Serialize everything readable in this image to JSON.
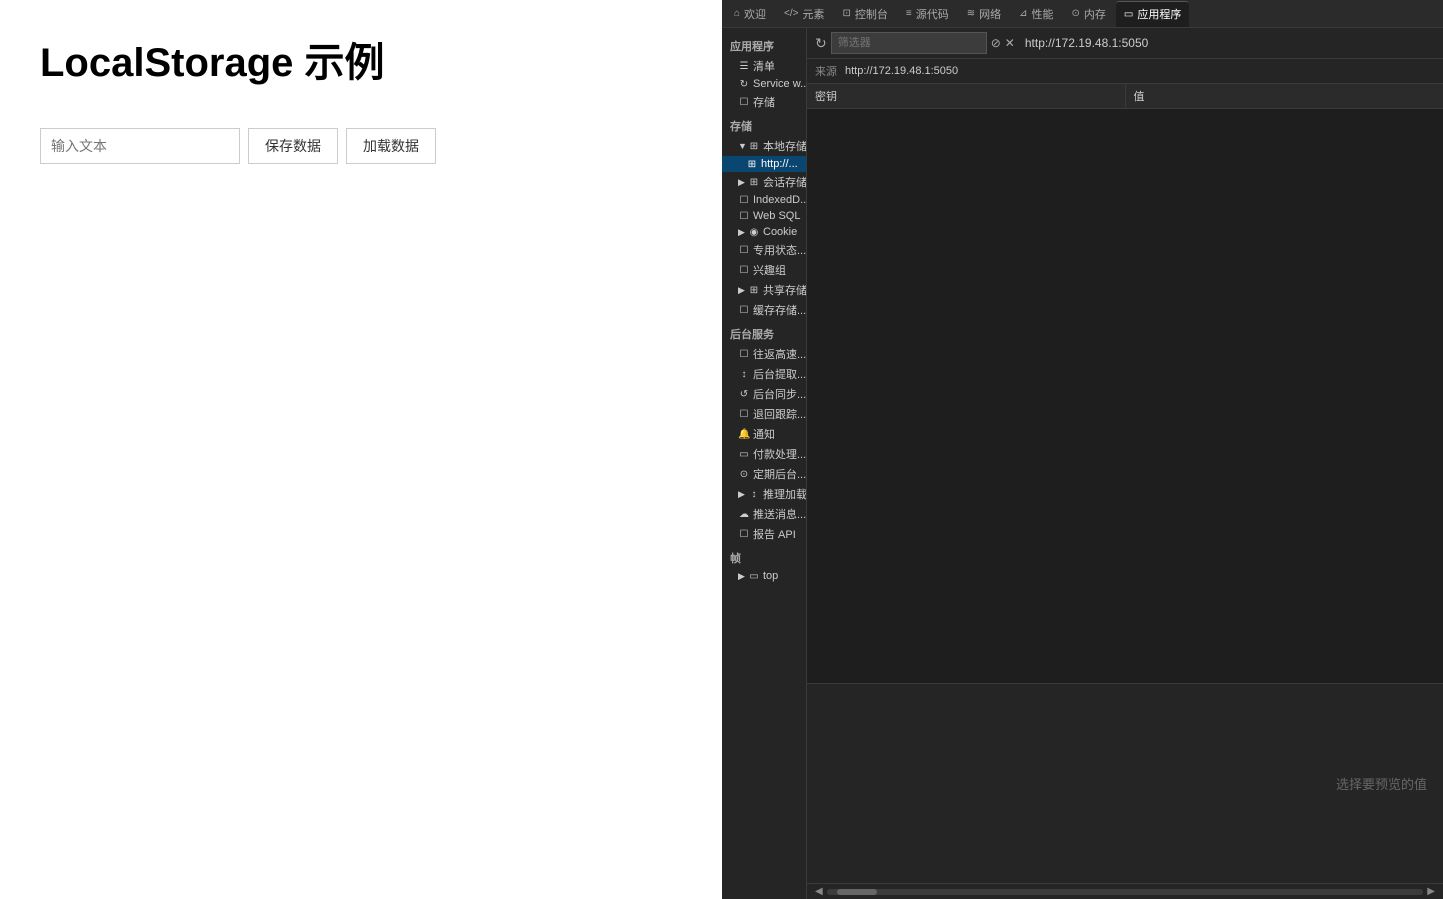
{
  "webpage": {
    "title": "LocalStorage 示例",
    "input_placeholder": "输入文本",
    "save_button": "保存数据",
    "load_button": "加载数据"
  },
  "devtools": {
    "tabs": [
      {
        "id": "welcome",
        "icon": "⌂",
        "label": "欢迎"
      },
      {
        "id": "elements",
        "icon": "</>",
        "label": "元素"
      },
      {
        "id": "console",
        "icon": "⊡",
        "label": "控制台"
      },
      {
        "id": "sources",
        "icon": "≡",
        "label": "源代码"
      },
      {
        "id": "network",
        "icon": "≋",
        "label": "网络"
      },
      {
        "id": "performance",
        "icon": "⊿",
        "label": "性能"
      },
      {
        "id": "memory",
        "icon": "⊙",
        "label": "内存"
      },
      {
        "id": "application",
        "icon": "▭",
        "label": "应用程序",
        "active": true
      }
    ],
    "panel_title": "应用程序",
    "url_bar": {
      "url": "http://172.19.48.1:5050",
      "filter_placeholder": "筛选器",
      "source_label": "来源",
      "source_value": "http://172.19.48.1:5050"
    },
    "table_headers": [
      "密钥",
      "值"
    ],
    "preview_text": "选择要预览的值",
    "sidebar": {
      "app_section": "应用程序",
      "app_items": [
        {
          "label": "清单",
          "icon": "☰",
          "indent": 1
        },
        {
          "label": "Service w...",
          "icon": "↻",
          "indent": 1
        },
        {
          "label": "存储",
          "icon": "☐",
          "indent": 1
        }
      ],
      "storage_section": "存储",
      "storage_items": [
        {
          "label": "本地存储",
          "icon": "⊞",
          "indent": 1,
          "expand": true,
          "expanded": true
        },
        {
          "label": "http://...",
          "icon": "⊞",
          "indent": 2
        },
        {
          "label": "会话存储",
          "icon": "⊞",
          "indent": 1,
          "expand": true
        },
        {
          "label": "IndexedD...",
          "icon": "☐",
          "indent": 1
        },
        {
          "label": "Web SQL",
          "icon": "☐",
          "indent": 1
        },
        {
          "label": "Cookie",
          "icon": "◉",
          "indent": 1,
          "expand": true
        },
        {
          "label": "专用状态...",
          "icon": "☐",
          "indent": 1
        },
        {
          "label": "兴趣组",
          "icon": "☐",
          "indent": 1
        },
        {
          "label": "共享存储...",
          "icon": "⊞",
          "indent": 1,
          "expand": true
        },
        {
          "label": "缓存存储...",
          "icon": "☐",
          "indent": 1
        }
      ],
      "backend_section": "后台服务",
      "backend_items": [
        {
          "label": "往返高速...",
          "icon": "☐",
          "indent": 1
        },
        {
          "label": "后台提取...",
          "icon": "↕",
          "indent": 1
        },
        {
          "label": "后台同步...",
          "icon": "↺",
          "indent": 1
        },
        {
          "label": "退回跟踪...",
          "icon": "☐",
          "indent": 1
        },
        {
          "label": "通知",
          "icon": "🔔",
          "indent": 1
        },
        {
          "label": "付款处理...",
          "icon": "▭",
          "indent": 1
        },
        {
          "label": "定期后台...",
          "icon": "⊙",
          "indent": 1
        },
        {
          "label": "推理加载...",
          "icon": "↕",
          "indent": 1,
          "expand": true
        },
        {
          "label": "推送消息...",
          "icon": "☁",
          "indent": 1
        },
        {
          "label": "报告 API",
          "icon": "☐",
          "indent": 1
        }
      ],
      "frames_section": "帧",
      "frames_items": [
        {
          "label": "top",
          "icon": "▭",
          "indent": 1,
          "expand": true
        }
      ]
    }
  }
}
